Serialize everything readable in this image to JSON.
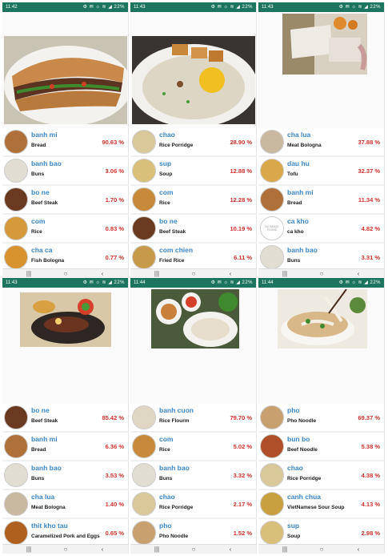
{
  "screens": [
    {
      "time": "11:42",
      "status": "⚙ ✉ ☼  ≋ ◢ 22%",
      "rows": [
        {
          "name": "banh mi",
          "en": "Bread",
          "pct": "90.63 %",
          "thumb": "#b0703a"
        },
        {
          "name": "banh bao",
          "en": "Buns",
          "pct": "3.06 %",
          "thumb": "#e2ddd2"
        },
        {
          "name": "bo ne",
          "en": "Beef Steak",
          "pct": "1.70 %",
          "thumb": "#6a3a20"
        },
        {
          "name": "com",
          "en": "Rice",
          "pct": "0.83 %",
          "thumb": "#d49a3c"
        },
        {
          "name": "cha ca",
          "en": "Fish Bologna",
          "pct": "0.77 %",
          "thumb": "#d8922e"
        }
      ]
    },
    {
      "time": "11:43",
      "status": "⚙ ✉ ☼  ≋ ◢ 22%",
      "rows": [
        {
          "name": "chao",
          "en": "Rice Porridge",
          "pct": "28.90 %",
          "thumb": "#d8c89a"
        },
        {
          "name": "sup",
          "en": "Soup",
          "pct": "12.88 %",
          "thumb": "#d9c07a"
        },
        {
          "name": "com",
          "en": "Rice",
          "pct": "12.28 %",
          "thumb": "#c78a3a"
        },
        {
          "name": "bo ne",
          "en": "Beef Steak",
          "pct": "10.19 %",
          "thumb": "#6a3a20"
        },
        {
          "name": "com chien",
          "en": "Fried Rice",
          "pct": "6.11 %",
          "thumb": "#c79a4a"
        }
      ]
    },
    {
      "time": "11:43",
      "status": "⚙ ✉ ☼  ≋ ◢ 22%",
      "rows": [
        {
          "name": "cha lua",
          "en": "Meat Bologna",
          "pct": "37.88 %",
          "thumb": "#c9b8a0"
        },
        {
          "name": "dau hu",
          "en": "Tofu",
          "pct": "32.37 %",
          "thumb": "#d8a84a"
        },
        {
          "name": "banh mi",
          "en": "Bread",
          "pct": "11.34 %",
          "thumb": "#b0703a"
        },
        {
          "name": "ca kho",
          "en": "ca kho",
          "pct": "4.82 %",
          "thumb": "noimage"
        },
        {
          "name": "banh bao",
          "en": "Buns",
          "pct": "3.31 %",
          "thumb": "#e2ddd2"
        }
      ]
    },
    {
      "time": "11:43",
      "status": "⚙ ✉ ☼  ≋ ◢ 22%",
      "rows": [
        {
          "name": "bo ne",
          "en": "Beef Steak",
          "pct": "85.42 %",
          "thumb": "#6a3a20"
        },
        {
          "name": "banh mi",
          "en": "Bread",
          "pct": "6.36 %",
          "thumb": "#b0703a"
        },
        {
          "name": "banh bao",
          "en": "Buns",
          "pct": "3.53 %",
          "thumb": "#e2ddd2"
        },
        {
          "name": "cha lua",
          "en": "Meat Bologna",
          "pct": "1.40 %",
          "thumb": "#c9b8a0"
        },
        {
          "name": "thit kho tau",
          "en": "Caramelized Pork and Eggs",
          "pct": "0.65 %",
          "thumb": "#b0601e"
        }
      ]
    },
    {
      "time": "11:44",
      "status": "⚙ ✉ ☼  ≋ ◢ 22%",
      "rows": [
        {
          "name": "banh cuon",
          "en": "Rice Flourm",
          "pct": "79.70 %",
          "thumb": "#e0d6c4"
        },
        {
          "name": "com",
          "en": "Rice",
          "pct": "5.02 %",
          "thumb": "#c78a3a"
        },
        {
          "name": "banh bao",
          "en": "Buns",
          "pct": "3.32 %",
          "thumb": "#e2ddd2"
        },
        {
          "name": "chao",
          "en": "Rice Porridge",
          "pct": "2.17 %",
          "thumb": "#d8c89a"
        },
        {
          "name": "pho",
          "en": "Pho Noodle",
          "pct": "1.52 %",
          "thumb": "#c8a070"
        }
      ]
    },
    {
      "time": "11:44",
      "status": "⚙ ✉ ☼  ≋ ◢ 22%",
      "rows": [
        {
          "name": "pho",
          "en": "Pho Noodle",
          "pct": "69.37 %",
          "thumb": "#c8a070"
        },
        {
          "name": "bun bo",
          "en": "Beef Noodle",
          "pct": "5.38 %",
          "thumb": "#b0502a"
        },
        {
          "name": "chao",
          "en": "Rice Porridge",
          "pct": "4.38 %",
          "thumb": "#d8c89a"
        },
        {
          "name": "canh chua",
          "en": "VietNamese Sour Soup",
          "pct": "4.13 %",
          "thumb": "#c8a040"
        },
        {
          "name": "sup",
          "en": "Soup",
          "pct": "2.98 %",
          "thumb": "#d9c07a"
        }
      ]
    }
  ],
  "no_image_text": "NO IMAGE FOUND",
  "nav": {
    "recents": "|||",
    "home": "○",
    "back": "‹"
  },
  "colors": {
    "statusbar": "#1d7560",
    "name": "#3a86c6",
    "percent": "#d2312e"
  }
}
